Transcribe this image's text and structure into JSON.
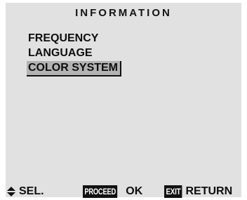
{
  "menu": {
    "title": "INFORMATION",
    "items": [
      {
        "label": "FREQUENCY",
        "selected": false
      },
      {
        "label": "LANGUAGE",
        "selected": false
      },
      {
        "label": "COLOR SYSTEM",
        "selected": true
      }
    ]
  },
  "footer": {
    "select_icon": "up-down-arrows-icon",
    "select_label": "SEL.",
    "proceed_key": "PROCEED",
    "proceed_label": "OK",
    "exit_key": "EXIT",
    "exit_label": "RETURN"
  },
  "colors": {
    "screen_background": "#e1e1e1",
    "highlight": "#b3b3b3",
    "text": "#111111"
  }
}
